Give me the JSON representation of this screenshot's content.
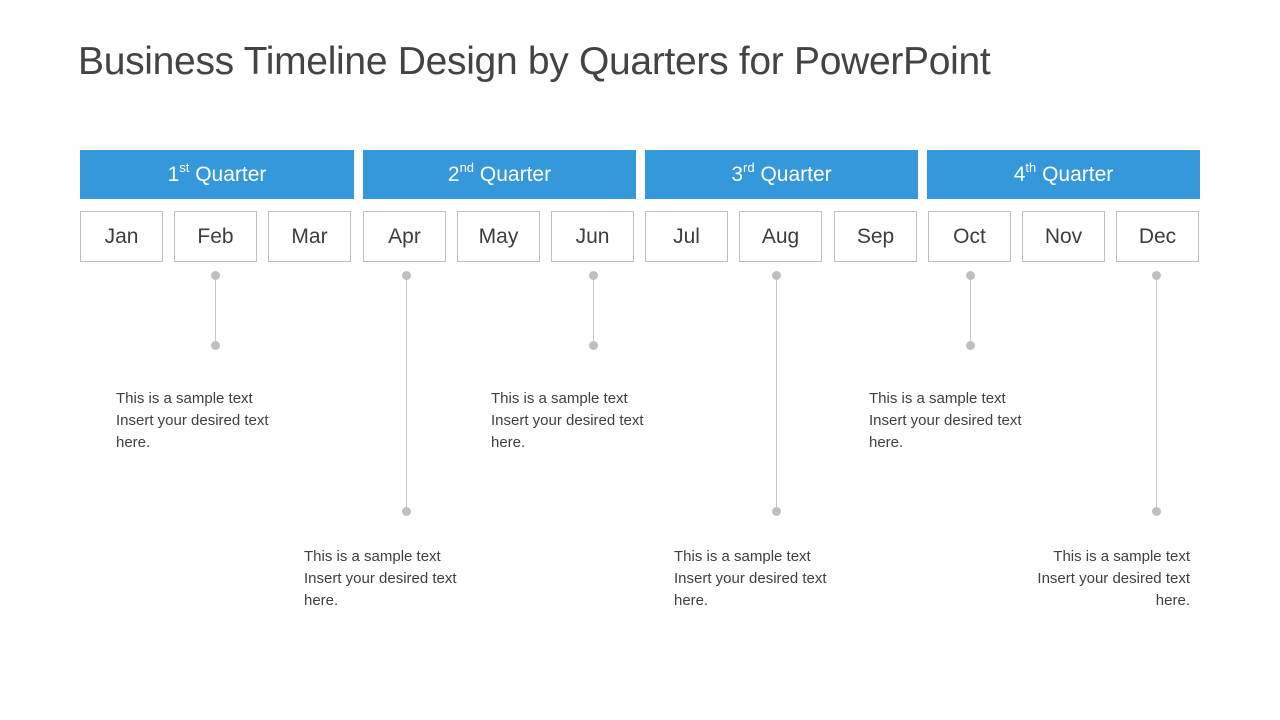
{
  "slide": {
    "title": "Business Timeline Design by Quarters for PowerPoint",
    "background_color": "#FFFFFF",
    "accent_color": "#3498DB",
    "border_color": "#BFBFBF",
    "line_color": "#C9C9C9",
    "text_color": "#3F3F3F"
  },
  "quarters": [
    {
      "number": "1",
      "ordinal": "st",
      "word": "Quarter"
    },
    {
      "number": "2",
      "ordinal": "nd",
      "word": "Quarter"
    },
    {
      "number": "3",
      "ordinal": "rd",
      "word": "Quarter"
    },
    {
      "number": "4",
      "ordinal": "th",
      "word": "Quarter"
    }
  ],
  "months": [
    {
      "label": "Jan"
    },
    {
      "label": "Feb"
    },
    {
      "label": "Mar"
    },
    {
      "label": "Apr"
    },
    {
      "label": "May"
    },
    {
      "label": "Jun"
    },
    {
      "label": "Jul"
    },
    {
      "label": "Aug"
    },
    {
      "label": "Sep"
    },
    {
      "label": "Oct"
    },
    {
      "label": "Nov"
    },
    {
      "label": "Dec"
    }
  ],
  "milestones": [
    {
      "anchor_month": "Feb",
      "length": "short",
      "align": "left",
      "lines": [
        "This is a sample text",
        "Insert your desired text",
        "here."
      ]
    },
    {
      "anchor_month": "Apr",
      "length": "long",
      "align": "left",
      "lines": [
        "This is a sample text",
        "Insert your desired text",
        "here."
      ]
    },
    {
      "anchor_month": "Jun",
      "length": "short",
      "align": "left",
      "lines": [
        "This is a sample text",
        "Insert your desired text",
        "here."
      ]
    },
    {
      "anchor_month": "Aug",
      "length": "long",
      "align": "left",
      "lines": [
        "This is a sample text",
        "Insert your desired text",
        "here."
      ]
    },
    {
      "anchor_month": "Oct",
      "length": "short",
      "align": "left",
      "lines": [
        "This is a sample text",
        "Insert your desired text",
        "here."
      ]
    },
    {
      "anchor_month": "Dec",
      "length": "long",
      "align": "right",
      "lines": [
        "This is a sample text",
        "Insert your desired text",
        "here."
      ]
    }
  ]
}
